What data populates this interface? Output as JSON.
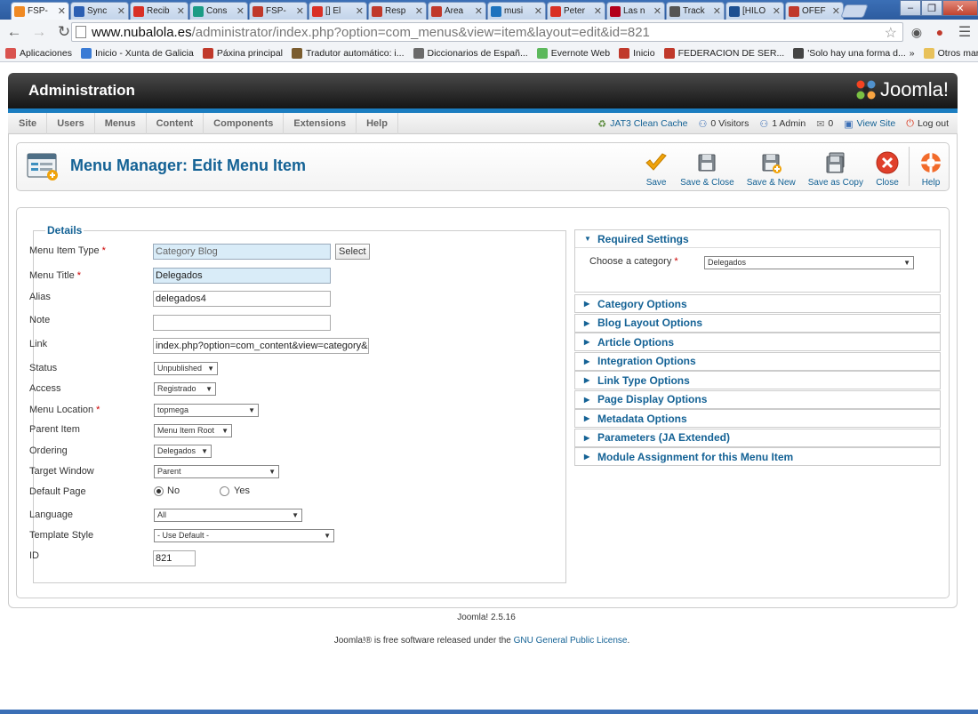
{
  "browser": {
    "tabs": [
      {
        "label": "FSP-",
        "color": "#f08a24",
        "active": true
      },
      {
        "label": "Sync",
        "color": "#2b5fb3"
      },
      {
        "label": "Recib",
        "color": "#d93025"
      },
      {
        "label": "Cons",
        "color": "#1b9c85"
      },
      {
        "label": "FSP-",
        "color": "#c0392b"
      },
      {
        "label": "[] El",
        "color": "#d93025"
      },
      {
        "label": "Resp",
        "color": "#c0392b"
      },
      {
        "label": "Área",
        "color": "#c0392b"
      },
      {
        "label": "musi",
        "color": "#1e73be"
      },
      {
        "label": "Peter",
        "color": "#d93025"
      },
      {
        "label": "Las n",
        "color": "#b3001b"
      },
      {
        "label": "Track",
        "color": "#555555"
      },
      {
        "label": "[HILO",
        "color": "#1d4f91"
      },
      {
        "label": "OFEF",
        "color": "#c0392b"
      }
    ],
    "url_host": "www.nubalola.es",
    "url_path": "/administrator/index.php?option=com_menus&view=item&layout=edit&id=821",
    "bookmarks": [
      {
        "label": "Aplicaciones",
        "color": "#d9534f"
      },
      {
        "label": "Inicio - Xunta de Galicia",
        "color": "#3a7bd5"
      },
      {
        "label": "Páxina principal",
        "color": "#c0392b"
      },
      {
        "label": "Tradutor automático: i...",
        "color": "#7a5c2e"
      },
      {
        "label": "Diccionarios de Españ...",
        "color": "#6a6a6a"
      },
      {
        "label": "Evernote Web",
        "color": "#5cb85c"
      },
      {
        "label": "Inicio",
        "color": "#c0392b"
      },
      {
        "label": "FEDERACION DE SER...",
        "color": "#c0392b"
      },
      {
        "label": "'Solo hay una forma d...",
        "color": "#444444"
      }
    ],
    "bookmarks_more": "»",
    "other_bookmarks": "Otros marcadores"
  },
  "header": {
    "title": "Administration",
    "logo_text": "Joomla!"
  },
  "menu": {
    "items": [
      "Site",
      "Users",
      "Menus",
      "Content",
      "Components",
      "Extensions",
      "Help"
    ]
  },
  "status": {
    "clean_cache": "JAT3 Clean Cache",
    "visitors": "0 Visitors",
    "admins": "1 Admin",
    "messages": "0",
    "view_site": "View Site",
    "logout": "Log out"
  },
  "toolbar": {
    "title": "Menu Manager: Edit Menu Item",
    "buttons": [
      "Save",
      "Save & Close",
      "Save & New",
      "Save as Copy",
      "Close",
      "Help"
    ]
  },
  "details": {
    "legend": "Details",
    "labels": {
      "type": "Menu Item Type",
      "title": "Menu Title",
      "alias": "Alias",
      "note": "Note",
      "link": "Link",
      "status": "Status",
      "access": "Access",
      "location": "Menu Location",
      "parent": "Parent Item",
      "ordering": "Ordering",
      "target": "Target Window",
      "default": "Default Page",
      "language": "Language",
      "template": "Template Style",
      "id": "ID"
    },
    "required_mark": "*",
    "values": {
      "type": "Category Blog",
      "title": "Delegados",
      "alias": "delegados4",
      "note": "",
      "link": "index.php?option=com_content&view=category&layout=blog&id=",
      "status": "Unpublished",
      "access": "Registrado",
      "location": "topmega",
      "parent": "Menu Item Root",
      "ordering": "Delegados",
      "target": "Parent",
      "default_no": "No",
      "default_yes": "Yes",
      "language": "All",
      "template": "- Use Default -",
      "id": "821"
    },
    "select_button": "Select"
  },
  "panels": {
    "required": {
      "title": "Required Settings",
      "label": "Choose a category",
      "value": "Delegados"
    },
    "collapsed": [
      "Category Options",
      "Blog Layout Options",
      "Article Options",
      "Integration Options",
      "Link Type Options",
      "Page Display Options",
      "Metadata Options",
      "Parameters (JA Extended)",
      "Module Assignment for this Menu Item"
    ]
  },
  "footer": {
    "version": "Joomla! 2.5.16",
    "license_pre": "Joomla!® is free software released under the ",
    "license_link": "GNU General Public License",
    "license_post": "."
  },
  "colors": {
    "accent": "#146295",
    "header_blue": "#1b7dc0",
    "save": "#f0a30a",
    "close": "#e0402b"
  }
}
